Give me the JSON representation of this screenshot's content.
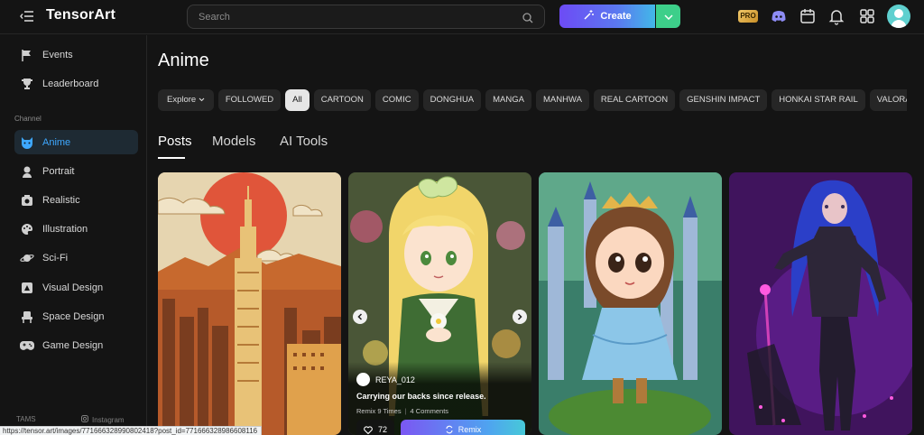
{
  "app": {
    "logo_text": "TensorArt"
  },
  "header": {
    "search_placeholder": "Search",
    "create_label": "Create",
    "pro_badge": "PRO"
  },
  "sidebar": {
    "top_items": [
      {
        "label": "Events",
        "icon": "flag-icon"
      },
      {
        "label": "Leaderboard",
        "icon": "trophy-icon"
      }
    ],
    "section_label": "Channel",
    "channels": [
      {
        "label": "Anime",
        "icon": "cat-icon",
        "active": true
      },
      {
        "label": "Portrait",
        "icon": "portrait-icon"
      },
      {
        "label": "Realistic",
        "icon": "camera-icon"
      },
      {
        "label": "Illustration",
        "icon": "palette-icon"
      },
      {
        "label": "Sci-Fi",
        "icon": "planet-icon"
      },
      {
        "label": "Visual Design",
        "icon": "design-icon"
      },
      {
        "label": "Space Design",
        "icon": "chair-icon"
      },
      {
        "label": "Game Design",
        "icon": "gamepad-icon"
      }
    ],
    "footer_left": "TAMS",
    "footer_right": "Instagram"
  },
  "main": {
    "title": "Anime",
    "explore_label": "Explore",
    "chips": [
      "FOLLOWED",
      "All",
      "CARTOON",
      "COMIC",
      "DONGHUA",
      "MANGA",
      "MANHWA",
      "REAL CARTOON",
      "GENSHIN IMPACT",
      "HONKAI STAR RAIL",
      "VALORANT"
    ],
    "active_chip": "All",
    "tabs": [
      "Posts",
      "Models",
      "AI Tools"
    ],
    "active_tab": "Posts"
  },
  "featured_post": {
    "author": "REYA_012",
    "title": "Carrying our backs since release.",
    "remix_count": "Remix 9 Times",
    "comments": "4 Comments",
    "likes": "72",
    "remix_label": "Remix"
  },
  "statusbar": {
    "url": "https://tensor.art/images/771666328990802418?post_id=771666328986608116"
  },
  "colors": {
    "accent_blue": "#3ea8ff",
    "create_gradient_start": "#6d4bf5",
    "create_dropdown": "#3dcf8a"
  }
}
